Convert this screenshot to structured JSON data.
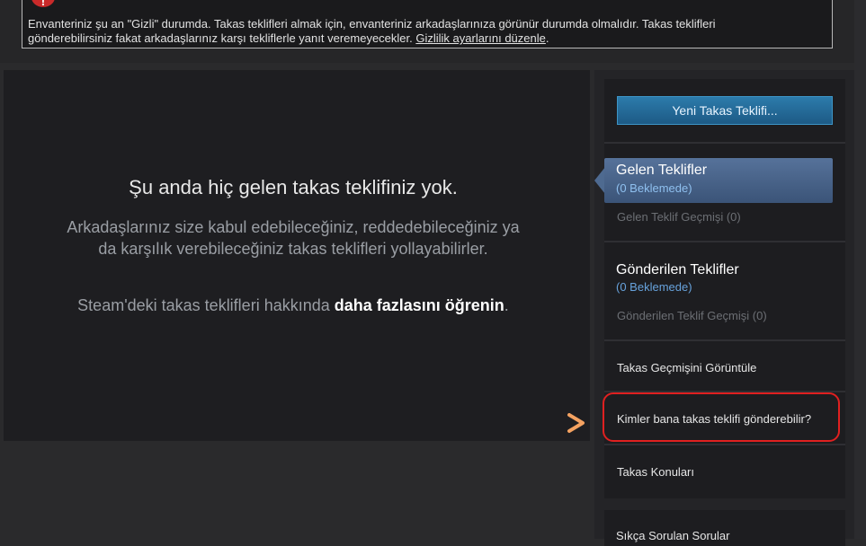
{
  "notice": {
    "text_line1": "Envanteriniz şu an \"Gizli\" durumda. Takas teklifleri almak için, envanteriniz arkadaşlarınıza görünür durumda olmalıdır. Takas teklifleri",
    "text_line2": "gönderebilirsiniz fakat arkadaşlarınız karşı tekliflerle yanıt veremeyecekler. ",
    "link": "Gizlilik ayarlarını düzenle",
    "suffix": ".",
    "icon": "warning-icon"
  },
  "empty_state": {
    "title": "Şu anda hiç gelen takas teklifiniz yok.",
    "description": "Arkadaşlarınız size kabul edebileceğiniz, reddedebileceğiniz ya da karşılık verebileceğiniz takas teklifleri yollayabilirler.",
    "learn_prefix": "Steam'deki takas teklifleri hakkında ",
    "learn_link": "daha fazlasını öğrenin",
    "learn_suffix": "."
  },
  "sidebar": {
    "new_offer_button": "Yeni Takas Teklifi...",
    "incoming": {
      "label": "Gelen Teklifler",
      "pending": "(0 Beklemede)",
      "history": "Gelen Teklif Geçmişi (0)"
    },
    "sent": {
      "label": "Gönderilen Teklifler",
      "pending": "(0 Beklemede)",
      "history": "Gönderilen Teklif Geçmişi (0)"
    },
    "view_history": "Takas Geçmişini Görüntüle",
    "who_can_send": "Kimler bana takas teklifi gönderebilir?",
    "topics": "Takas Konuları",
    "faq": "Sıkça Sorulan Sorular"
  },
  "annotation": {
    "arrow_colors": [
      "#e8473a",
      "#f4a261"
    ],
    "highlight_color": "#e02020"
  }
}
